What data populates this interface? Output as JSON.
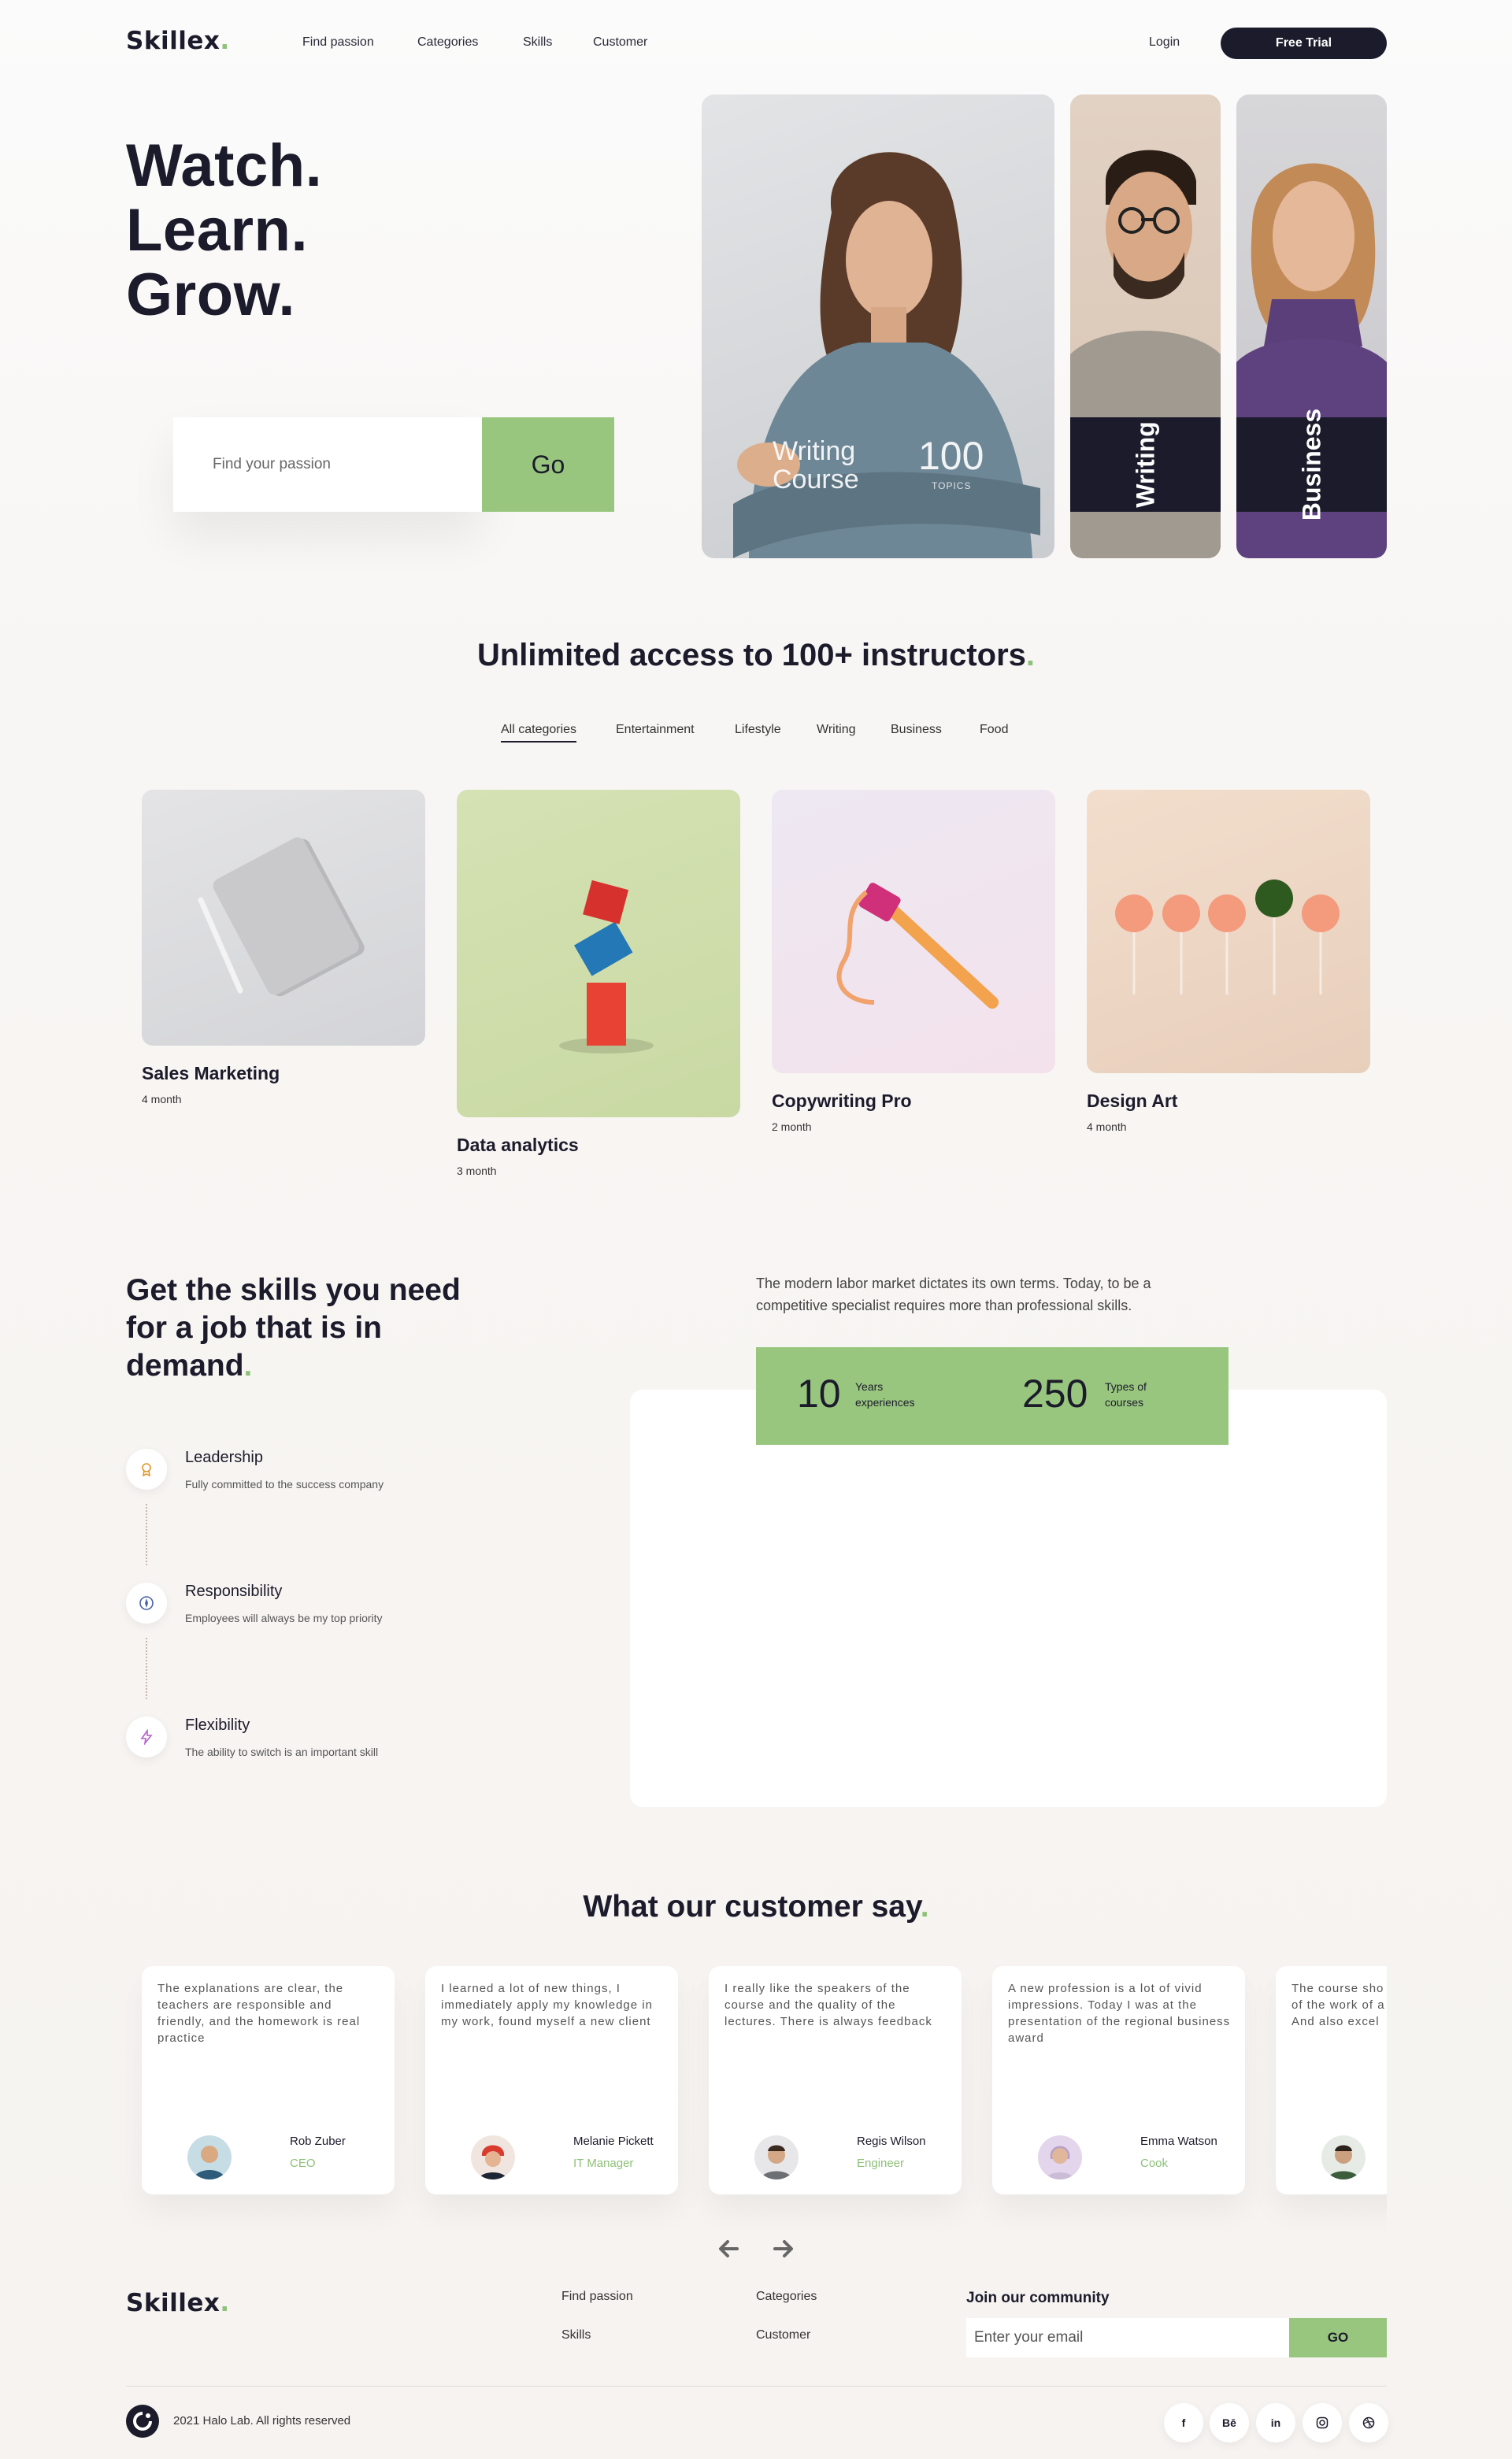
{
  "nav": {
    "logo": "Skillex",
    "logo_dot": ".",
    "links": [
      "Find passion",
      "Categories",
      "Skills",
      "Customer"
    ],
    "login": "Login",
    "trial": "Free Trial"
  },
  "hero": {
    "title_lines": [
      "Watch.",
      "Learn.",
      "Grow."
    ],
    "search_placeholder": "Find your passion",
    "go": "Go",
    "main_card": {
      "title_line1": "Writing",
      "title_line2": "Course",
      "number": "100",
      "unit": "TOPICS"
    },
    "tall_cards": [
      "Writing",
      "Business"
    ]
  },
  "categories": {
    "title": "Unlimited access to 100+ instructors",
    "tabs": [
      "All categories",
      "Entertainment",
      "Lifestyle",
      "Writing",
      "Business",
      "Food"
    ],
    "active_tab": "All categories",
    "courses": [
      {
        "title": "Sales Marketing",
        "duration": "4 month"
      },
      {
        "title": "Data analytics",
        "duration": "3 month"
      },
      {
        "title": "Copywriting Pro",
        "duration": "2 month"
      },
      {
        "title": "Design Art",
        "duration": "4 month"
      }
    ]
  },
  "skills": {
    "title_lines": [
      "Get the skills you need",
      "for a job that is in",
      "demand"
    ],
    "description": "The modern labor market dictates its own terms. Today, to be a competitive specialist requires more than professional skills.",
    "stats": [
      {
        "value": "10",
        "label_line1": "Years",
        "label_line2": "experiences"
      },
      {
        "value": "250",
        "label_line1": "Types of",
        "label_line2": "courses"
      }
    ],
    "features": [
      {
        "title": "Leadership",
        "desc": "Fully committed to the success company",
        "icon": "award-icon"
      },
      {
        "title": "Responsibility",
        "desc": "Employees will always be my top priority",
        "icon": "compass-icon"
      },
      {
        "title": "Flexibility",
        "desc": "The ability to switch is an important skill",
        "icon": "bolt-icon"
      }
    ]
  },
  "testimonials": {
    "title": "What our customer say",
    "items": [
      {
        "text": "The explanations are clear, the teachers are responsible and friendly, and the homework is real practice",
        "name": "Rob Zuber",
        "role": "CEO"
      },
      {
        "text": "I learned a lot of new things, I immediately apply my knowledge in my work, found myself a new client",
        "name": "Melanie Pickett",
        "role": "IT Manager"
      },
      {
        "text": "I really like the speakers of the course and the quality of the lectures. There is always feedback",
        "name": "Regis Wilson",
        "role": "Engineer"
      },
      {
        "text": "A new profession is a lot of vivid impressions. Today I was at the presentation of the regional business award",
        "name": "Emma Watson",
        "role": "Cook"
      },
      {
        "text": "The course sho of the work of a And also excel",
        "name": "",
        "role": ""
      }
    ]
  },
  "footer": {
    "logo": "Skillex",
    "links": [
      "Find passion",
      "Categories",
      "Skills",
      "Customer"
    ],
    "community_title": "Join our community",
    "email_placeholder": "Enter your email",
    "subscribe": "GO",
    "copyright": "2021 Halo Lab. All rights reserved",
    "socials": [
      "f",
      "Bē",
      "in",
      "instagram",
      "dribbble"
    ]
  },
  "colors": {
    "accent": "#98c67f",
    "dark": "#1c1b2b",
    "role": "#8cc277"
  }
}
